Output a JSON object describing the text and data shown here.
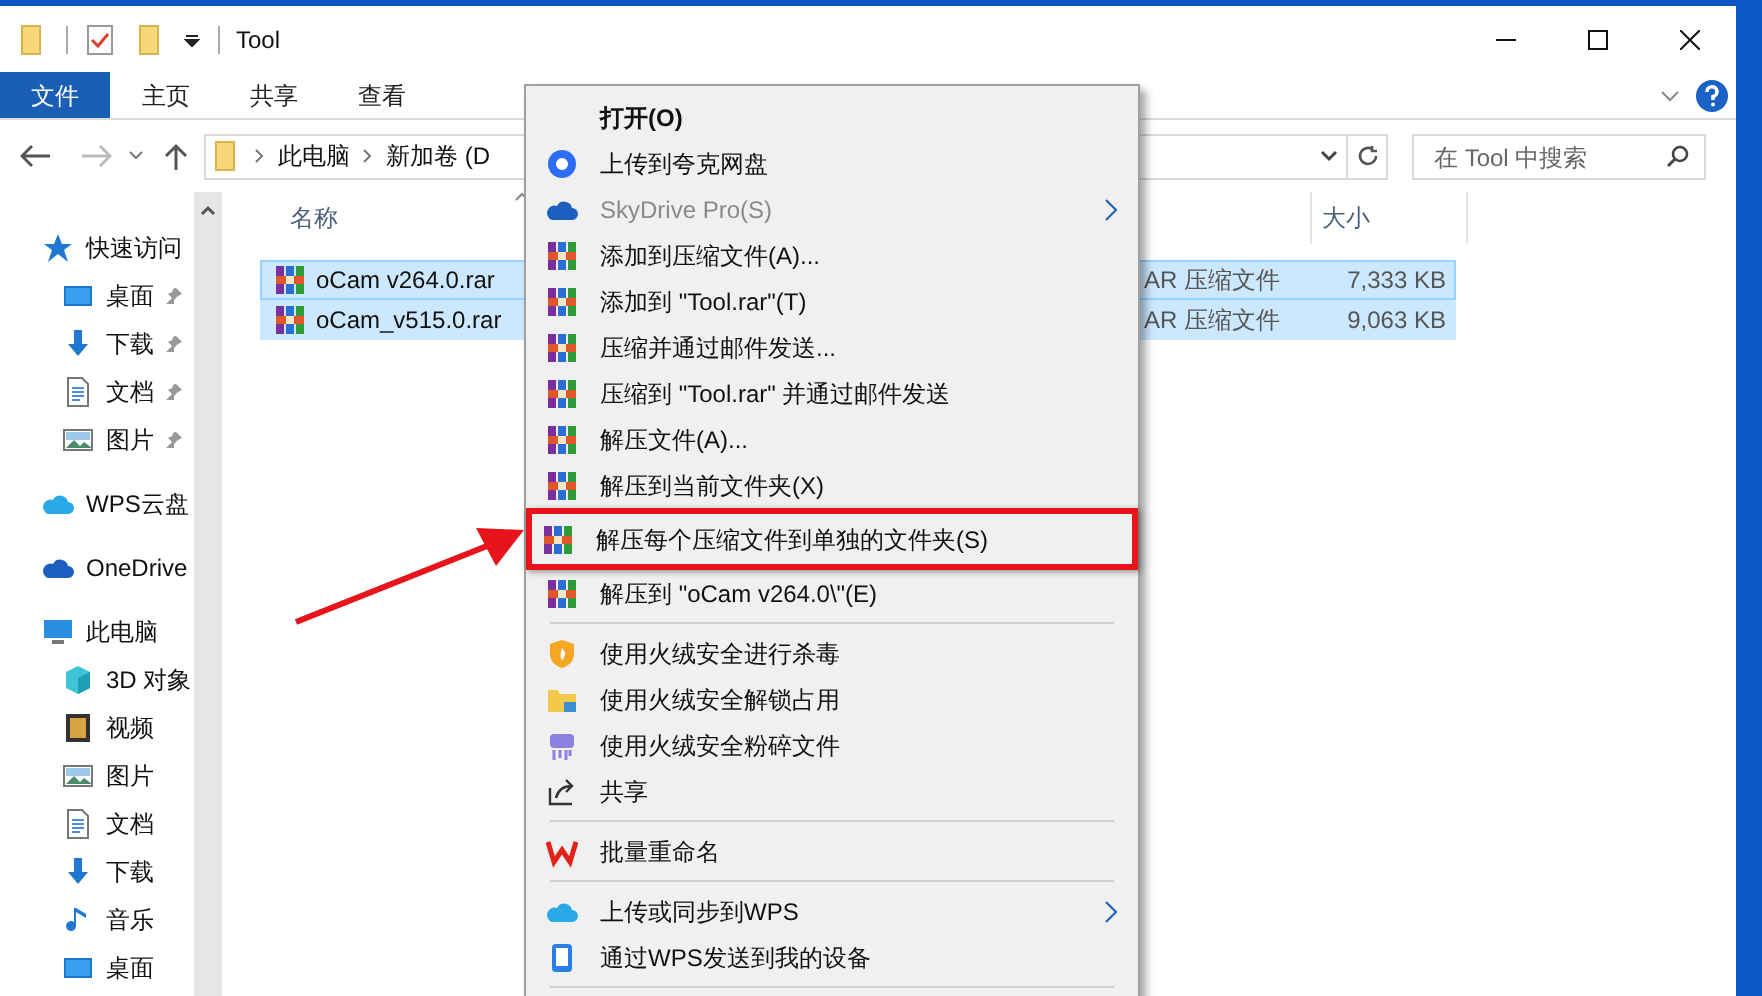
{
  "window": {
    "title": "Tool"
  },
  "ribbon_tabs": [
    {
      "label": "文件",
      "selected": true
    },
    {
      "label": "主页",
      "selected": false
    },
    {
      "label": "共享",
      "selected": false
    },
    {
      "label": "查看",
      "selected": false
    }
  ],
  "address": {
    "crumbs": [
      "此电脑",
      "新加卷 (D"
    ]
  },
  "search": {
    "placeholder": "在 Tool 中搜索"
  },
  "sidebar": {
    "items": [
      {
        "label": "快速访问",
        "children": [
          {
            "label": "桌面",
            "pinned": true
          },
          {
            "label": "下载",
            "pinned": true
          },
          {
            "label": "文档",
            "pinned": true
          },
          {
            "label": "图片",
            "pinned": true
          }
        ]
      },
      {
        "label": "WPS云盘"
      },
      {
        "label": "OneDrive"
      },
      {
        "label": "此电脑",
        "children": [
          {
            "label": "3D 对象",
            "pinned": false
          },
          {
            "label": "视频",
            "pinned": false
          },
          {
            "label": "图片",
            "pinned": false
          },
          {
            "label": "文档",
            "pinned": false
          },
          {
            "label": "下载",
            "pinned": false
          },
          {
            "label": "音乐",
            "pinned": false
          },
          {
            "label": "桌面",
            "pinned": false
          }
        ]
      }
    ]
  },
  "table": {
    "columns": [
      {
        "label": "名称",
        "sorted": true
      },
      {
        "label": "大小",
        "sorted": false
      }
    ],
    "rows": [
      {
        "name": "oCam v264.0.rar",
        "type": "AR 压缩文件",
        "size": "7,333 KB",
        "selected": true,
        "focused": true
      },
      {
        "name": "oCam_v515.0.rar",
        "type": "AR 压缩文件",
        "size": "9,063 KB",
        "selected": true,
        "focused": false
      }
    ]
  },
  "context_menu": {
    "items": [
      {
        "kind": "item",
        "label": "打开(O)",
        "bold": true,
        "disabled": false,
        "submenu": false,
        "outlined": false
      },
      {
        "kind": "item",
        "label": "上传到夸克网盘",
        "bold": false,
        "disabled": false,
        "submenu": false,
        "outlined": false
      },
      {
        "kind": "item",
        "label": "SkyDrive Pro(S)",
        "bold": false,
        "disabled": true,
        "submenu": true,
        "outlined": false
      },
      {
        "kind": "item",
        "label": "添加到压缩文件(A)...",
        "bold": false,
        "disabled": false,
        "submenu": false,
        "outlined": false
      },
      {
        "kind": "item",
        "label": "添加到 \"Tool.rar\"(T)",
        "bold": false,
        "disabled": false,
        "submenu": false,
        "outlined": false
      },
      {
        "kind": "item",
        "label": "压缩并通过邮件发送...",
        "bold": false,
        "disabled": false,
        "submenu": false,
        "outlined": false
      },
      {
        "kind": "item",
        "label": "压缩到 \"Tool.rar\" 并通过邮件发送",
        "bold": false,
        "disabled": false,
        "submenu": false,
        "outlined": false
      },
      {
        "kind": "item",
        "label": "解压文件(A)...",
        "bold": false,
        "disabled": false,
        "submenu": false,
        "outlined": false
      },
      {
        "kind": "item",
        "label": "解压到当前文件夹(X)",
        "bold": false,
        "disabled": false,
        "submenu": false,
        "outlined": false
      },
      {
        "kind": "item",
        "label": "解压每个压缩文件到单独的文件夹(S)",
        "bold": false,
        "disabled": false,
        "submenu": false,
        "outlined": true
      },
      {
        "kind": "item",
        "label": "解压到 \"oCam v264.0\\\"(E)",
        "bold": false,
        "disabled": false,
        "submenu": false,
        "outlined": false
      },
      {
        "kind": "separator"
      },
      {
        "kind": "item",
        "label": "使用火绒安全进行杀毒",
        "bold": false,
        "disabled": false,
        "submenu": false,
        "outlined": false
      },
      {
        "kind": "item",
        "label": "使用火绒安全解锁占用",
        "bold": false,
        "disabled": false,
        "submenu": false,
        "outlined": false
      },
      {
        "kind": "item",
        "label": "使用火绒安全粉碎文件",
        "bold": false,
        "disabled": false,
        "submenu": false,
        "outlined": false
      },
      {
        "kind": "item",
        "label": "共享",
        "bold": false,
        "disabled": false,
        "submenu": false,
        "outlined": false
      },
      {
        "kind": "separator"
      },
      {
        "kind": "item",
        "label": "批量重命名",
        "bold": false,
        "disabled": false,
        "submenu": false,
        "outlined": false
      },
      {
        "kind": "separator"
      },
      {
        "kind": "item",
        "label": "上传或同步到WPS",
        "bold": false,
        "disabled": false,
        "submenu": true,
        "outlined": false
      },
      {
        "kind": "item",
        "label": "通过WPS发送到我的设备",
        "bold": false,
        "disabled": false,
        "submenu": false,
        "outlined": false
      },
      {
        "kind": "separator"
      }
    ]
  }
}
